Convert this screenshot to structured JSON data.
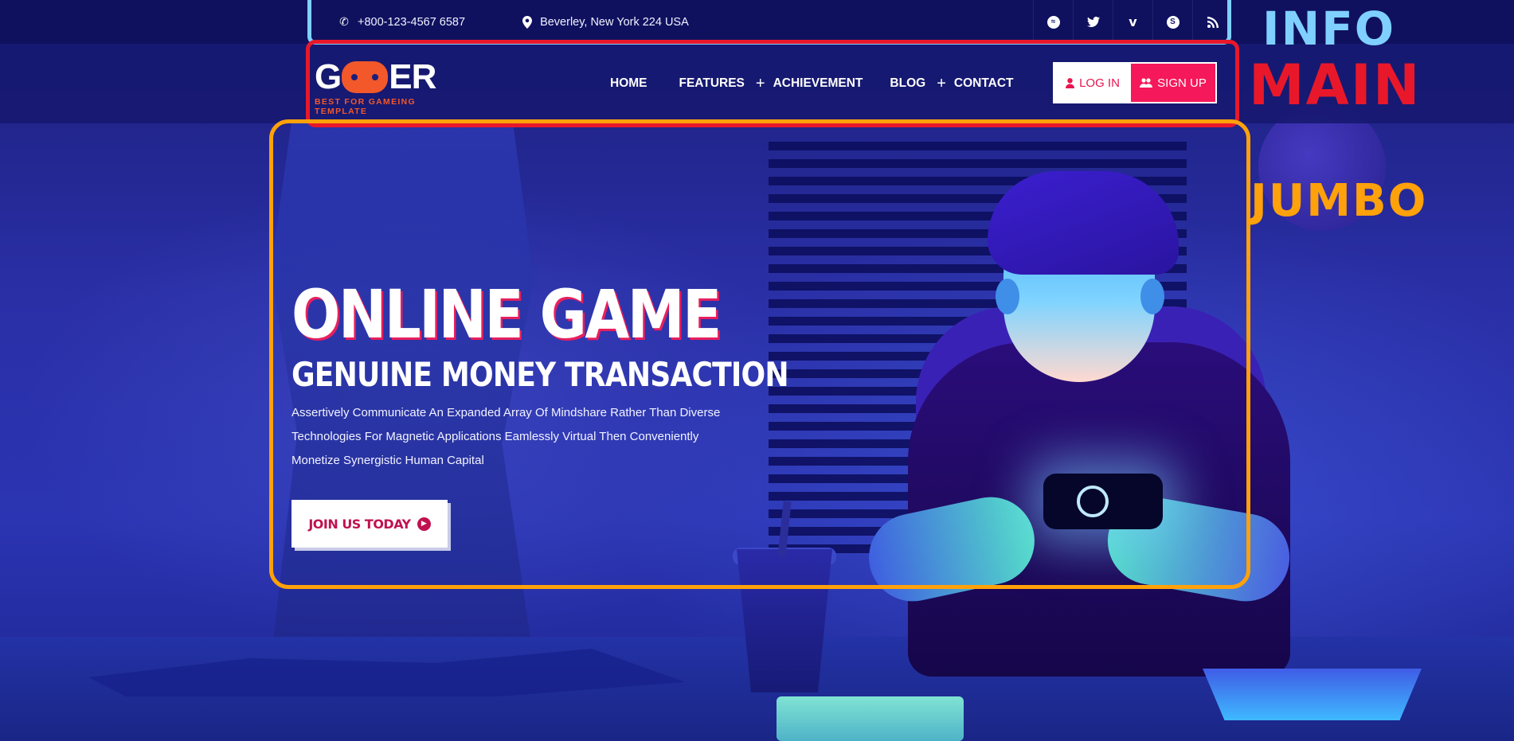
{
  "info_bar": {
    "phone": "+800-123-4567 6587",
    "address": "Beverley, New York 224 USA",
    "social": [
      {
        "icon": "messenger-icon",
        "glyph": "m"
      },
      {
        "icon": "twitter-icon",
        "glyph": "t"
      },
      {
        "icon": "vimeo-icon",
        "glyph": "v"
      },
      {
        "icon": "skype-icon",
        "glyph": "s"
      },
      {
        "icon": "rss-icon",
        "glyph": "r"
      }
    ]
  },
  "logo": {
    "word_left": "G",
    "word_right": "ER",
    "tagline": "BEST FOR GAMEING TEMPLATE"
  },
  "nav": {
    "items": [
      {
        "label": "HOME",
        "has_submenu": false
      },
      {
        "label": "FEATURES",
        "has_submenu": true
      },
      {
        "label": "ACHIEVEMENT",
        "has_submenu": false
      },
      {
        "label": "BLOG",
        "has_submenu": true
      },
      {
        "label": "CONTACT",
        "has_submenu": false
      }
    ],
    "login_label": "LOG IN",
    "signup_label": "SIGN UP"
  },
  "jumbo": {
    "title": "ONLINE GAME",
    "subtitle": "GENUINE MONEY TRANSACTION",
    "text_lines": [
      "Assertively Communicate An Expanded Array Of Mindshare Rather Than Diverse",
      "Technologies For Magnetic Applications Eamlessly Virtual Then Conveniently",
      "Monetize Synergistic Human Capital"
    ],
    "cta_label": "JOIN US TODAY"
  },
  "annotations": {
    "info": "INFO",
    "main": "MAIN",
    "jumbo": "JUMBO"
  },
  "colors": {
    "accent": "#f5185a",
    "logo_orange": "#f2582a",
    "anno_info": "#7fd0ff",
    "anno_main": "#e8182a",
    "anno_jumbo": "#ffa10a"
  }
}
